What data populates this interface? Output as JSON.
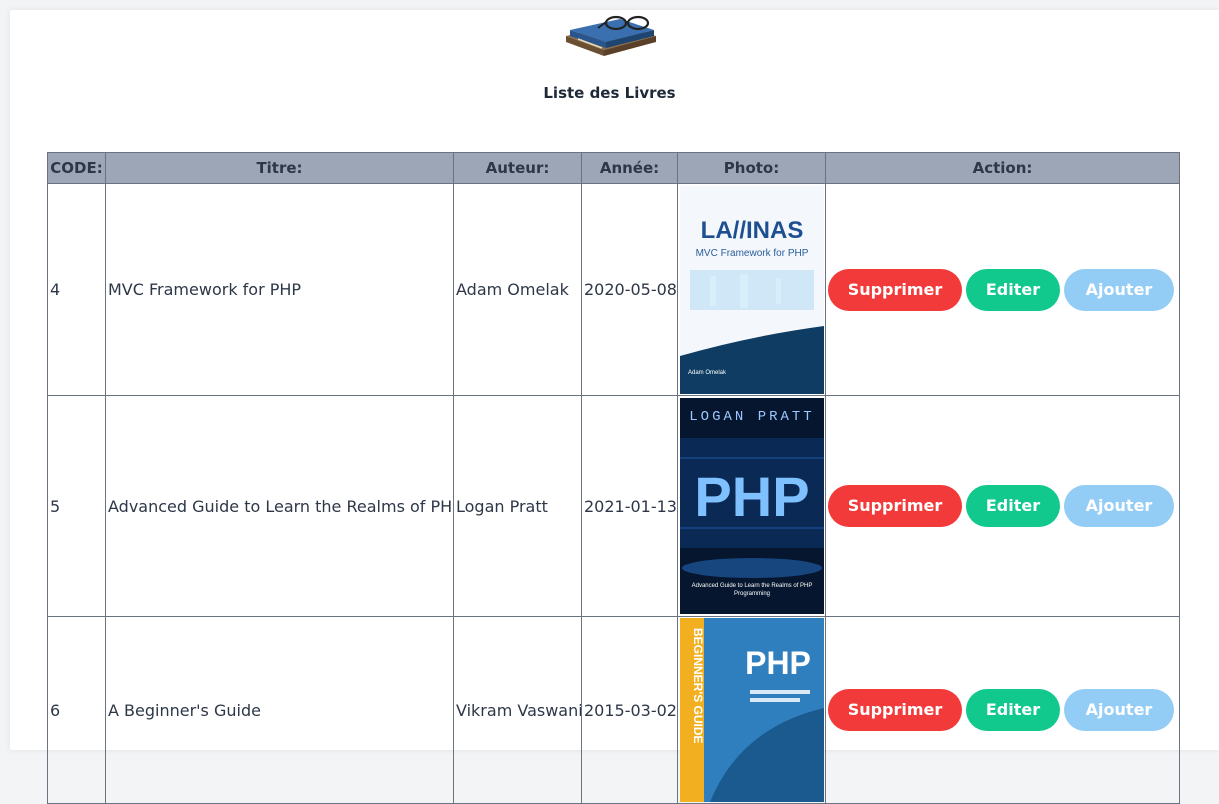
{
  "page": {
    "title": "Liste des Livres",
    "logo_icon": "books-with-glasses-icon"
  },
  "table": {
    "headers": {
      "code": "CODE:",
      "titre": "Titre:",
      "auteur": "Auteur:",
      "annee": "Année:",
      "photo": "Photo:",
      "action": "Action:"
    },
    "rows": [
      {
        "code": "4",
        "titre": "MVC Framework for PHP",
        "auteur": "Adam Omelak",
        "annee": "2020-05-08",
        "cover": {
          "brand": "LA//INAS",
          "subtitle": "MVC Framework for PHP",
          "author": "Adam Omelak"
        }
      },
      {
        "code": "5",
        "titre": "Advanced Guide to Learn the Realms of PHP Programming",
        "auteur": "Logan Pratt",
        "annee": "2021-01-13",
        "cover": {
          "author": "LOGAN PRATT",
          "big": "PHP",
          "subtitle": "Advanced Guide to Learn the Realms of PHP Programming"
        }
      },
      {
        "code": "6",
        "titre": "A Beginner's Guide",
        "auteur": "Vikram Vaswani",
        "annee": "2015-03-02",
        "cover": {
          "side": "BEGINNER'S GUIDE",
          "big": "PHP"
        }
      }
    ]
  },
  "actions": {
    "delete": "Supprimer",
    "edit": "Editer",
    "add": "Ajouter"
  },
  "colors": {
    "header_bg": "#9ca6b6",
    "delete": "#f23a3a",
    "edit": "#12c98d",
    "add": "#93cdf6"
  }
}
